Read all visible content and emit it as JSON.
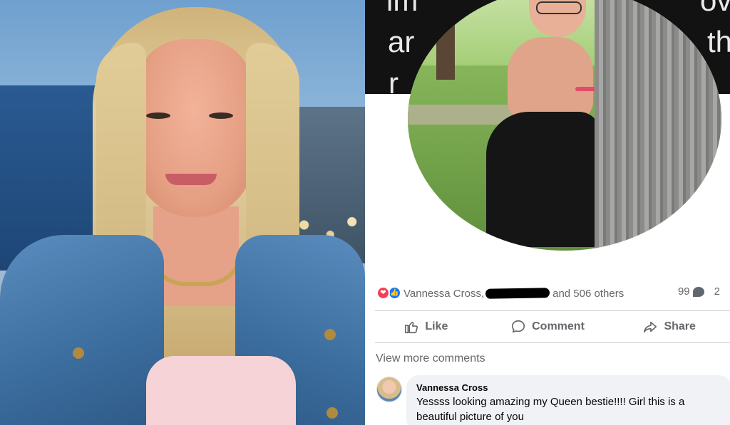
{
  "post_image": {
    "band_text_fragments": [
      "im",
      "ov",
      "ar",
      "th",
      "r"
    ]
  },
  "reactions": {
    "names": "Vannessa Cross,",
    "others": "and 506 others",
    "comment_count": "99",
    "extra_count": "2"
  },
  "actions": {
    "like_label": "Like",
    "comment_label": "Comment",
    "share_label": "Share"
  },
  "comments": {
    "view_more": "View more comments",
    "items": [
      {
        "author": "Vannessa Cross",
        "text": "Yessss looking amazing my Queen bestie!!!! Girl this is a beautiful picture of you"
      }
    ]
  },
  "colors": {
    "love": "#f33e58",
    "like": "#1877f2",
    "meta_text": "#65676b",
    "bubble_bg": "#f0f2f5"
  }
}
